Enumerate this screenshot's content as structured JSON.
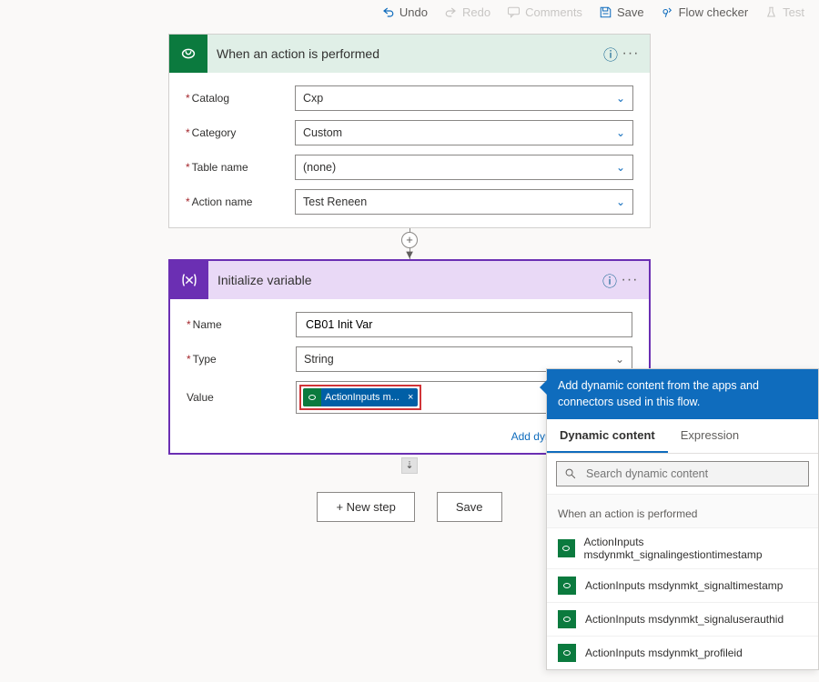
{
  "toolbar": {
    "undo": "Undo",
    "redo": "Redo",
    "comments": "Comments",
    "save": "Save",
    "flow_checker": "Flow checker",
    "test": "Test"
  },
  "trigger_card": {
    "title": "When an action is performed",
    "fields": {
      "catalog": {
        "label": "Catalog",
        "value": "Cxp"
      },
      "category": {
        "label": "Category",
        "value": "Custom"
      },
      "table": {
        "label": "Table name",
        "value": "(none)"
      },
      "action": {
        "label": "Action name",
        "value": "Test Reneen"
      }
    }
  },
  "init_var_card": {
    "title": "Initialize variable",
    "fields": {
      "name": {
        "label": "Name",
        "value": "CB01 Init Var"
      },
      "type": {
        "label": "Type",
        "value": "String"
      },
      "value_label": "Value",
      "token_text": "ActionInputs m..."
    },
    "add_dynamic": "Add dynamic content"
  },
  "actions": {
    "new_step": "+ New step",
    "save": "Save"
  },
  "dc_panel": {
    "header": "Add dynamic content from the apps and connectors used in this flow.",
    "tab_dynamic": "Dynamic content",
    "tab_expression": "Expression",
    "search_placeholder": "Search dynamic content",
    "section_title": "When an action is performed",
    "items": [
      "ActionInputs msdynmkt_signalingestiontimestamp",
      "ActionInputs msdynmkt_signaltimestamp",
      "ActionInputs msdynmkt_signaluserauthid",
      "ActionInputs msdynmkt_profileid"
    ]
  }
}
